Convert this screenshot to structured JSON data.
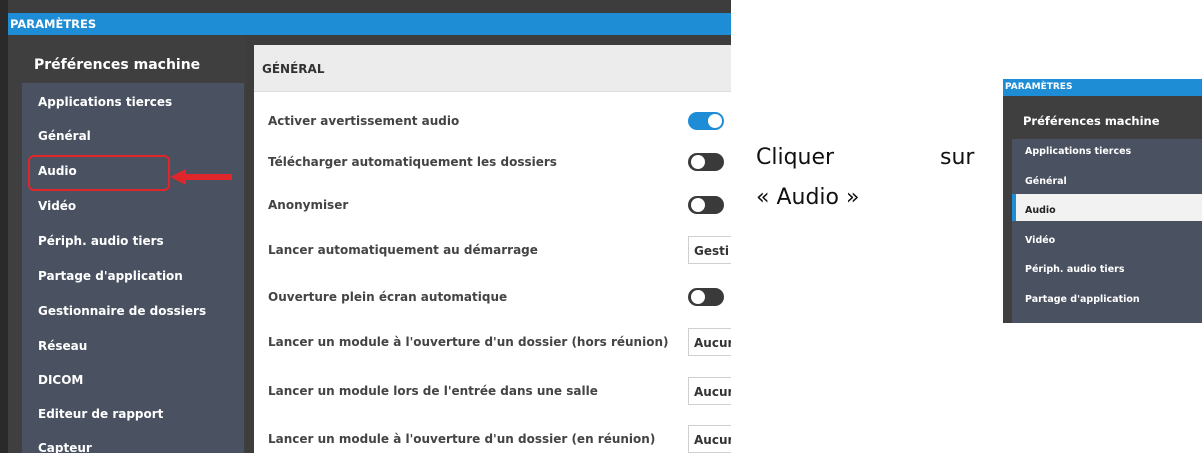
{
  "left_panel": {
    "title_bar": "PARAMÈTRES",
    "sidebar_title": "Préférences machine",
    "sidebar_items": [
      "Applications tierces",
      "Général",
      "Audio",
      "Vidéo",
      "Périph. audio tiers",
      "Partage d'application",
      "Gestionnaire de dossiers",
      "Réseau",
      "DICOM",
      "Editeur de rapport",
      "Capteur"
    ],
    "section_header": "GÉNÉRAL",
    "settings": [
      {
        "label": "Activer avertissement audio",
        "control": "toggle",
        "state": "on"
      },
      {
        "label": "Télécharger automatiquement les dossiers",
        "control": "toggle",
        "state": "off"
      },
      {
        "label": "Anonymiser",
        "control": "toggle",
        "state": "off"
      },
      {
        "label": "Lancer automatiquement au démarrage",
        "control": "select",
        "value": "Gesti"
      },
      {
        "label": "Ouverture plein écran automatique",
        "control": "toggle",
        "state": "off"
      },
      {
        "label": "Lancer un module à l'ouverture d'un dossier (hors réunion)",
        "control": "select",
        "value": "Aucur"
      },
      {
        "label": "Lancer un module lors de l'entrée dans une salle",
        "control": "select",
        "value": "Aucur"
      },
      {
        "label": "Lancer un module à l'ouverture d'un dossier (en réunion)",
        "control": "select",
        "value": "Aucur"
      }
    ]
  },
  "instruction": {
    "line1_word1": "Cliquer",
    "line1_word2": "sur",
    "line2": "« Audio »"
  },
  "right_panel": {
    "title_bar": "PARAMÈTRES",
    "sidebar_title": "Préférences machine",
    "sidebar_items": [
      "Applications tierces",
      "Général",
      "Audio",
      "Vidéo",
      "Périph. audio tiers",
      "Partage d'application"
    ],
    "selected_item": "Audio"
  },
  "colors": {
    "accent": "#1f8dd6",
    "highlight": "#e0252b",
    "sidebar_list": "#4a5160",
    "panel_dark": "#3f3f3f"
  }
}
